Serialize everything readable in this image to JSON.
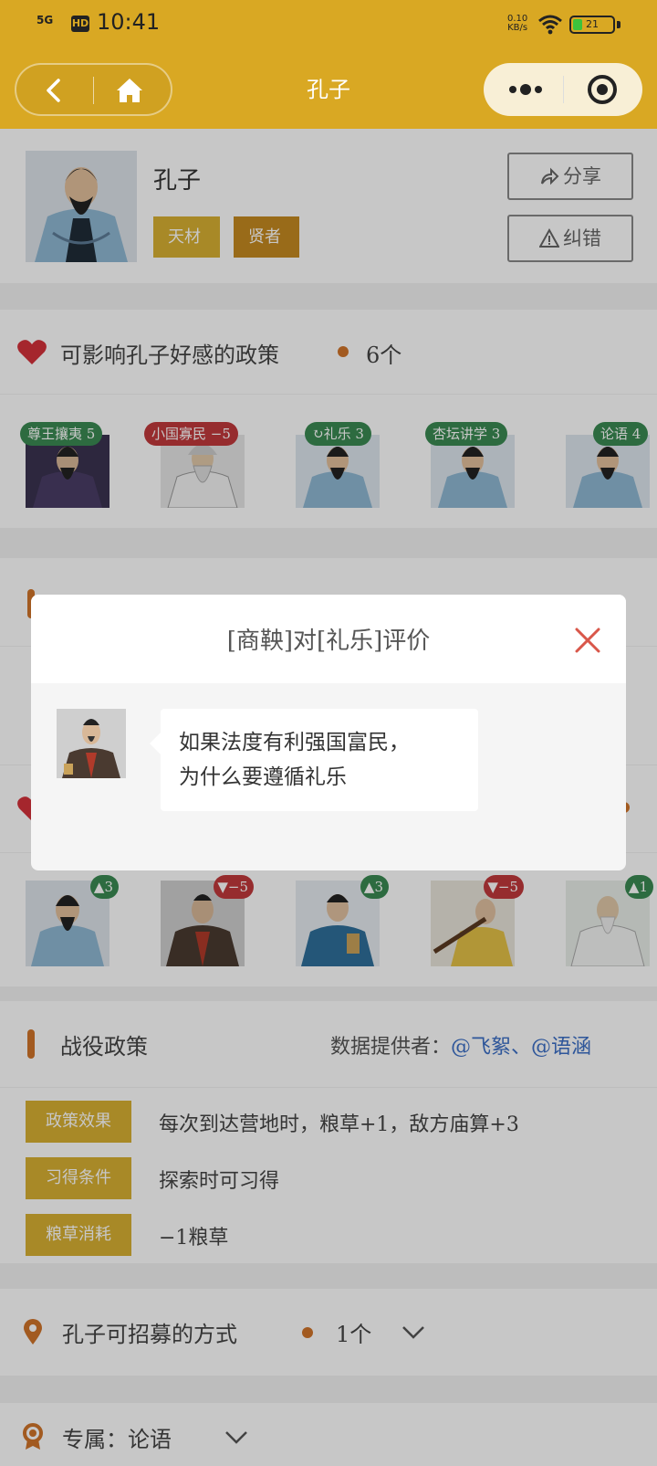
{
  "status_bar": {
    "signal": "5G",
    "hd": "HD",
    "time": "10:41",
    "speed_value": "0.10",
    "speed_unit": "KB/s",
    "battery": "21"
  },
  "nav": {
    "title": "孔子"
  },
  "profile": {
    "name": "孔子",
    "tags": [
      "天材",
      "贤者"
    ],
    "share_label": "分享",
    "report_label": "纠错"
  },
  "policies": {
    "title": "可影响孔子好感的政策",
    "count": "6个",
    "items": [
      {
        "label": "尊王攘夷 5",
        "tone": "green"
      },
      {
        "label": "小国寡民 −5",
        "tone": "red"
      },
      {
        "label": "礼乐 3",
        "tone": "green"
      },
      {
        "label": "杏坛讲学 3",
        "tone": "green"
      },
      {
        "label": "论语 4",
        "tone": "green"
      }
    ]
  },
  "people": [
    {
      "badge": "3",
      "direction": "up"
    },
    {
      "badge": "−5",
      "direction": "down"
    },
    {
      "badge": "3",
      "direction": "up"
    },
    {
      "badge": "−5",
      "direction": "down"
    },
    {
      "badge": "1",
      "direction": "up"
    }
  ],
  "battle": {
    "title": "战役政策",
    "provider_label": "数据提供者：",
    "provider_names": "@飞絮、@语涵",
    "rows": [
      {
        "label": "政策效果",
        "value": "每次到达营地时，粮草+1，敌方庙算+3"
      },
      {
        "label": "习得条件",
        "value": "探索时可习得"
      },
      {
        "label": "粮草消耗",
        "value": "−1粮草"
      }
    ]
  },
  "recruit": {
    "title": "孔子可招募的方式",
    "count": "1个"
  },
  "exclusive": {
    "title": "专属：论语"
  },
  "modal": {
    "title": "[商鞅]对[礼乐]评价",
    "line1": "如果法度有利强国富民，",
    "line2": "为什么要遵循礼乐"
  },
  "colors": {
    "brand": "#d9a823",
    "tag_gold": "#d8b032",
    "badge_green": "#3a8a52",
    "badge_red": "#c0393b",
    "accent_orange": "#d0742a",
    "link_blue": "#3b6fc6"
  }
}
